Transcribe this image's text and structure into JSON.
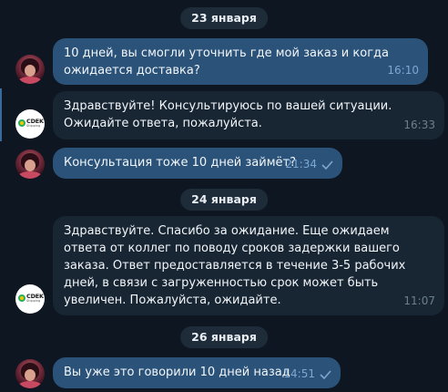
{
  "dates": {
    "d1": "23 января",
    "d2": "24 января",
    "d3": "26 января"
  },
  "messages": [
    {
      "id": "m1",
      "direction": "out",
      "text": "10 дней, вы смогли уточнить где мой заказ и когда ожидается доставка?",
      "time": "16:10",
      "read": true
    },
    {
      "id": "m2",
      "direction": "in",
      "sender": "СДЭК",
      "text": "Здравствуйте! Консультируюсь по вашей ситуации. Ожидайте ответа, пожалуйста.",
      "time": "16:33"
    },
    {
      "id": "m3",
      "direction": "out",
      "text": "Консультация тоже 10 дней займёт?",
      "time": "21:34",
      "read": true
    },
    {
      "id": "m4",
      "direction": "in",
      "sender": "СДЭК",
      "text": "Здравствуйте. Спасибо за ожидание. Еще ожидаем ответа от коллег по поводу сроков задержки вашего заказа. Ответ предоставляется в течение 3-5 рабочих дней, в связи с загруженностью срок может быть увеличен. Пожалуйста, ожидайте.",
      "time": "11:07"
    },
    {
      "id": "m5",
      "direction": "out",
      "text": "Вы уже это говорили 10 дней назад",
      "time": "14:51",
      "read": true
    }
  ],
  "logo": {
    "brand": "CDEK",
    "tagline": "Shipping"
  },
  "colors": {
    "background": "#0e1621",
    "outgoing_bubble": "#2b5278",
    "incoming_bubble": "#182533",
    "date_pill": "#1e2c3a"
  }
}
